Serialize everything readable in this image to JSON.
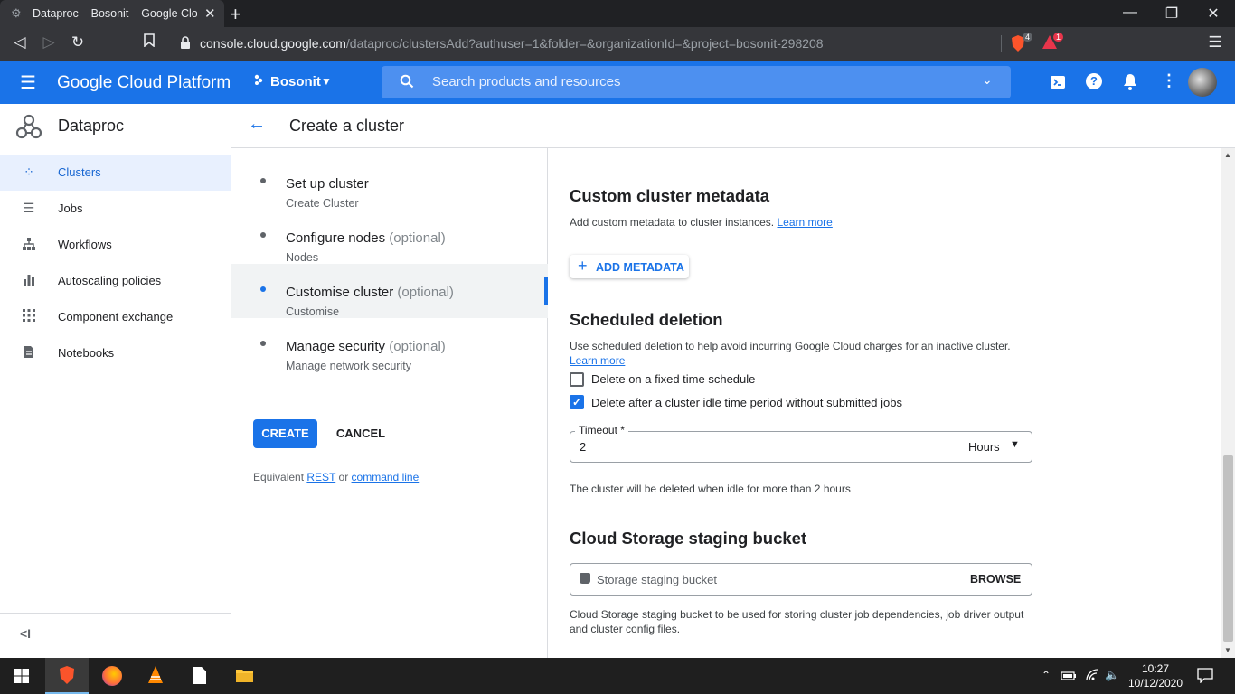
{
  "browser": {
    "tab_title": "Dataproc – Bosonit – Google Cloud",
    "url_host": "console.cloud.google.com",
    "url_path": "/dataproc/clustersAdd?authuser=1&folder=&organizationId=&project=bosonit-298208",
    "shield_badge": "4",
    "alert_badge": "1"
  },
  "gcp": {
    "brand": "Google Cloud Platform",
    "project": "Bosonit",
    "search_placeholder": "Search products and resources"
  },
  "sidebar": {
    "product": "Dataproc",
    "items": [
      {
        "label": "Clusters",
        "icon": "clusters-icon",
        "active": true
      },
      {
        "label": "Jobs",
        "icon": "list-icon"
      },
      {
        "label": "Workflows",
        "icon": "workflow-icon"
      },
      {
        "label": "Autoscaling policies",
        "icon": "bar-chart-icon"
      },
      {
        "label": "Component exchange",
        "icon": "grid-icon"
      },
      {
        "label": "Notebooks",
        "icon": "notebook-icon"
      }
    ]
  },
  "page": {
    "title": "Create a cluster"
  },
  "stepper": {
    "steps": [
      {
        "title": "Set up cluster",
        "optional": "",
        "subtitle": "Create Cluster"
      },
      {
        "title": "Configure nodes",
        "optional": "(optional)",
        "subtitle": "Nodes"
      },
      {
        "title": "Customise cluster",
        "optional": "(optional)",
        "subtitle": "Customise",
        "active": true
      },
      {
        "title": "Manage security",
        "optional": "(optional)",
        "subtitle": "Manage network security"
      }
    ],
    "create_label": "CREATE",
    "cancel_label": "CANCEL",
    "equivalent_prefix": "Equivalent",
    "rest_link": "REST",
    "or_text": "or",
    "command_line_link": "command line"
  },
  "metadata": {
    "heading": "Custom cluster metadata",
    "description": "Add custom metadata to cluster instances.",
    "learn_more": "Learn more",
    "add_label": "ADD METADATA"
  },
  "deletion": {
    "heading": "Scheduled deletion",
    "description": "Use scheduled deletion to help avoid incurring Google Cloud charges for an inactive cluster.",
    "learn_more": "Learn more",
    "fixed_label": "Delete on a fixed time schedule",
    "fixed_checked": false,
    "idle_label": "Delete after a cluster idle time period without submitted jobs",
    "idle_checked": true,
    "timeout_label": "Timeout *",
    "timeout_value": "2",
    "timeout_unit": "Hours",
    "helper": "The cluster will be deleted when idle for more than 2 hours"
  },
  "bucket": {
    "heading": "Cloud Storage staging bucket",
    "placeholder": "Storage staging bucket",
    "browse_label": "BROWSE",
    "help_line1": "Cloud Storage staging bucket to be used for storing cluster job dependencies, job driver output",
    "help_line2": "and cluster config files."
  },
  "taskbar": {
    "time": "10:27",
    "date": "10/12/2020"
  },
  "colors": {
    "accent": "#1a73e8",
    "header_bg": "#1a73e8",
    "browser_bg": "#35363a"
  }
}
